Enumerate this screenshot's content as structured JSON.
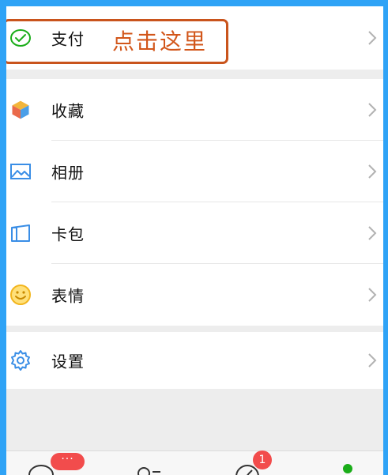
{
  "callout": {
    "text": "点击这里",
    "color": "#d2561a"
  },
  "menu": {
    "pay": {
      "label": "支付",
      "icon": "pay-icon"
    },
    "favorites": {
      "label": "收藏",
      "icon": "favorites-cube-icon"
    },
    "album": {
      "label": "相册",
      "icon": "album-picture-icon"
    },
    "cards": {
      "label": "卡包",
      "icon": "card-wallet-icon"
    },
    "stickers": {
      "label": "表情",
      "icon": "smiley-icon"
    },
    "settings": {
      "label": "设置",
      "icon": "gear-icon"
    }
  },
  "tabbar": {
    "chats_badge": "···",
    "discover_badge": "1",
    "icons": [
      "chat-bubble-icon",
      "contacts-icon",
      "discover-compass-icon",
      "me-icon"
    ]
  },
  "colors": {
    "accent_green": "#1aad19",
    "badge_red": "#f24c4c",
    "frame_blue": "#2fa3f6"
  }
}
